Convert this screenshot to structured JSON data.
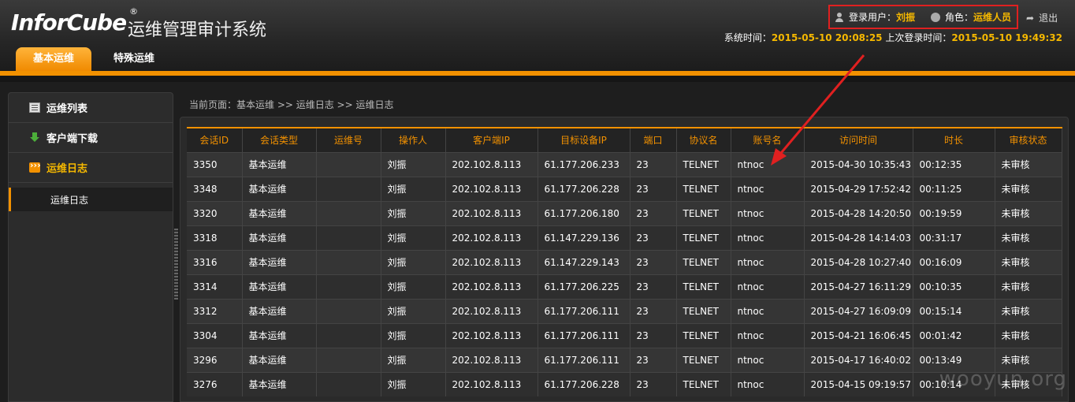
{
  "app": {
    "logo_text": "InforCube",
    "logo_mark": "®",
    "title": "运维管理审计系统"
  },
  "user": {
    "login_label": "登录用户：",
    "login_name": "刘振",
    "role_label": "角色：",
    "role_name": "运维人员",
    "logout_label": "退出",
    "system_time_label": "系统时间：",
    "system_time": "2015-05-10 20:08:25",
    "last_login_label": " 上次登录时间：",
    "last_login": "2015-05-10 19:49:32"
  },
  "tabs": [
    {
      "label": "基本运维",
      "active": true
    },
    {
      "label": "特殊运维",
      "active": false
    }
  ],
  "sidebar": {
    "items": [
      {
        "label": "运维列表",
        "icon": "list-icon"
      },
      {
        "label": "客户端下载",
        "icon": "download-icon"
      },
      {
        "label": "运维日志",
        "icon": "log-icon",
        "active": true
      }
    ],
    "sub_items": [
      {
        "label": "运维日志"
      }
    ]
  },
  "breadcrumb": "当前页面：基本运维 >> 运维日志 >> 运维日志",
  "table": {
    "columns": [
      "会话ID",
      "会话类型",
      "运维号",
      "操作人",
      "客户端IP",
      "目标设备IP",
      "端口",
      "协议名",
      "账号名",
      "访问时间",
      "时长",
      "审核状态"
    ],
    "rows": [
      [
        "3350",
        "基本运维",
        "",
        "刘振",
        "202.102.8.113",
        "61.177.206.233",
        "23",
        "TELNET",
        "ntnoc",
        "2015-04-30 10:35:43",
        "00:12:35",
        "未审核"
      ],
      [
        "3348",
        "基本运维",
        "",
        "刘振",
        "202.102.8.113",
        "61.177.206.228",
        "23",
        "TELNET",
        "ntnoc",
        "2015-04-29 17:52:42",
        "00:11:25",
        "未审核"
      ],
      [
        "3320",
        "基本运维",
        "",
        "刘振",
        "202.102.8.113",
        "61.177.206.180",
        "23",
        "TELNET",
        "ntnoc",
        "2015-04-28 14:20:50",
        "00:19:59",
        "未审核"
      ],
      [
        "3318",
        "基本运维",
        "",
        "刘振",
        "202.102.8.113",
        "61.147.229.136",
        "23",
        "TELNET",
        "ntnoc",
        "2015-04-28 14:14:03",
        "00:31:17",
        "未审核"
      ],
      [
        "3316",
        "基本运维",
        "",
        "刘振",
        "202.102.8.113",
        "61.147.229.143",
        "23",
        "TELNET",
        "ntnoc",
        "2015-04-28 10:27:40",
        "00:16:09",
        "未审核"
      ],
      [
        "3314",
        "基本运维",
        "",
        "刘振",
        "202.102.8.113",
        "61.177.206.225",
        "23",
        "TELNET",
        "ntnoc",
        "2015-04-27 16:11:29",
        "00:10:35",
        "未审核"
      ],
      [
        "3312",
        "基本运维",
        "",
        "刘振",
        "202.102.8.113",
        "61.177.206.111",
        "23",
        "TELNET",
        "ntnoc",
        "2015-04-27 16:09:09",
        "00:15:14",
        "未审核"
      ],
      [
        "3304",
        "基本运维",
        "",
        "刘振",
        "202.102.8.113",
        "61.177.206.111",
        "23",
        "TELNET",
        "ntnoc",
        "2015-04-21 16:06:45",
        "00:01:42",
        "未审核"
      ],
      [
        "3296",
        "基本运维",
        "",
        "刘振",
        "202.102.8.113",
        "61.177.206.111",
        "23",
        "TELNET",
        "ntnoc",
        "2015-04-17 16:40:02",
        "00:13:49",
        "未审核"
      ],
      [
        "3276",
        "基本运维",
        "",
        "刘振",
        "202.102.8.113",
        "61.177.206.228",
        "23",
        "TELNET",
        "ntnoc",
        "2015-04-15 09:19:57",
        "00:10:14",
        "未审核"
      ]
    ]
  },
  "watermark": "wooyun.org",
  "colors": {
    "accent": "#f29100",
    "highlight": "#f5b800",
    "annotation": "#e02020"
  }
}
